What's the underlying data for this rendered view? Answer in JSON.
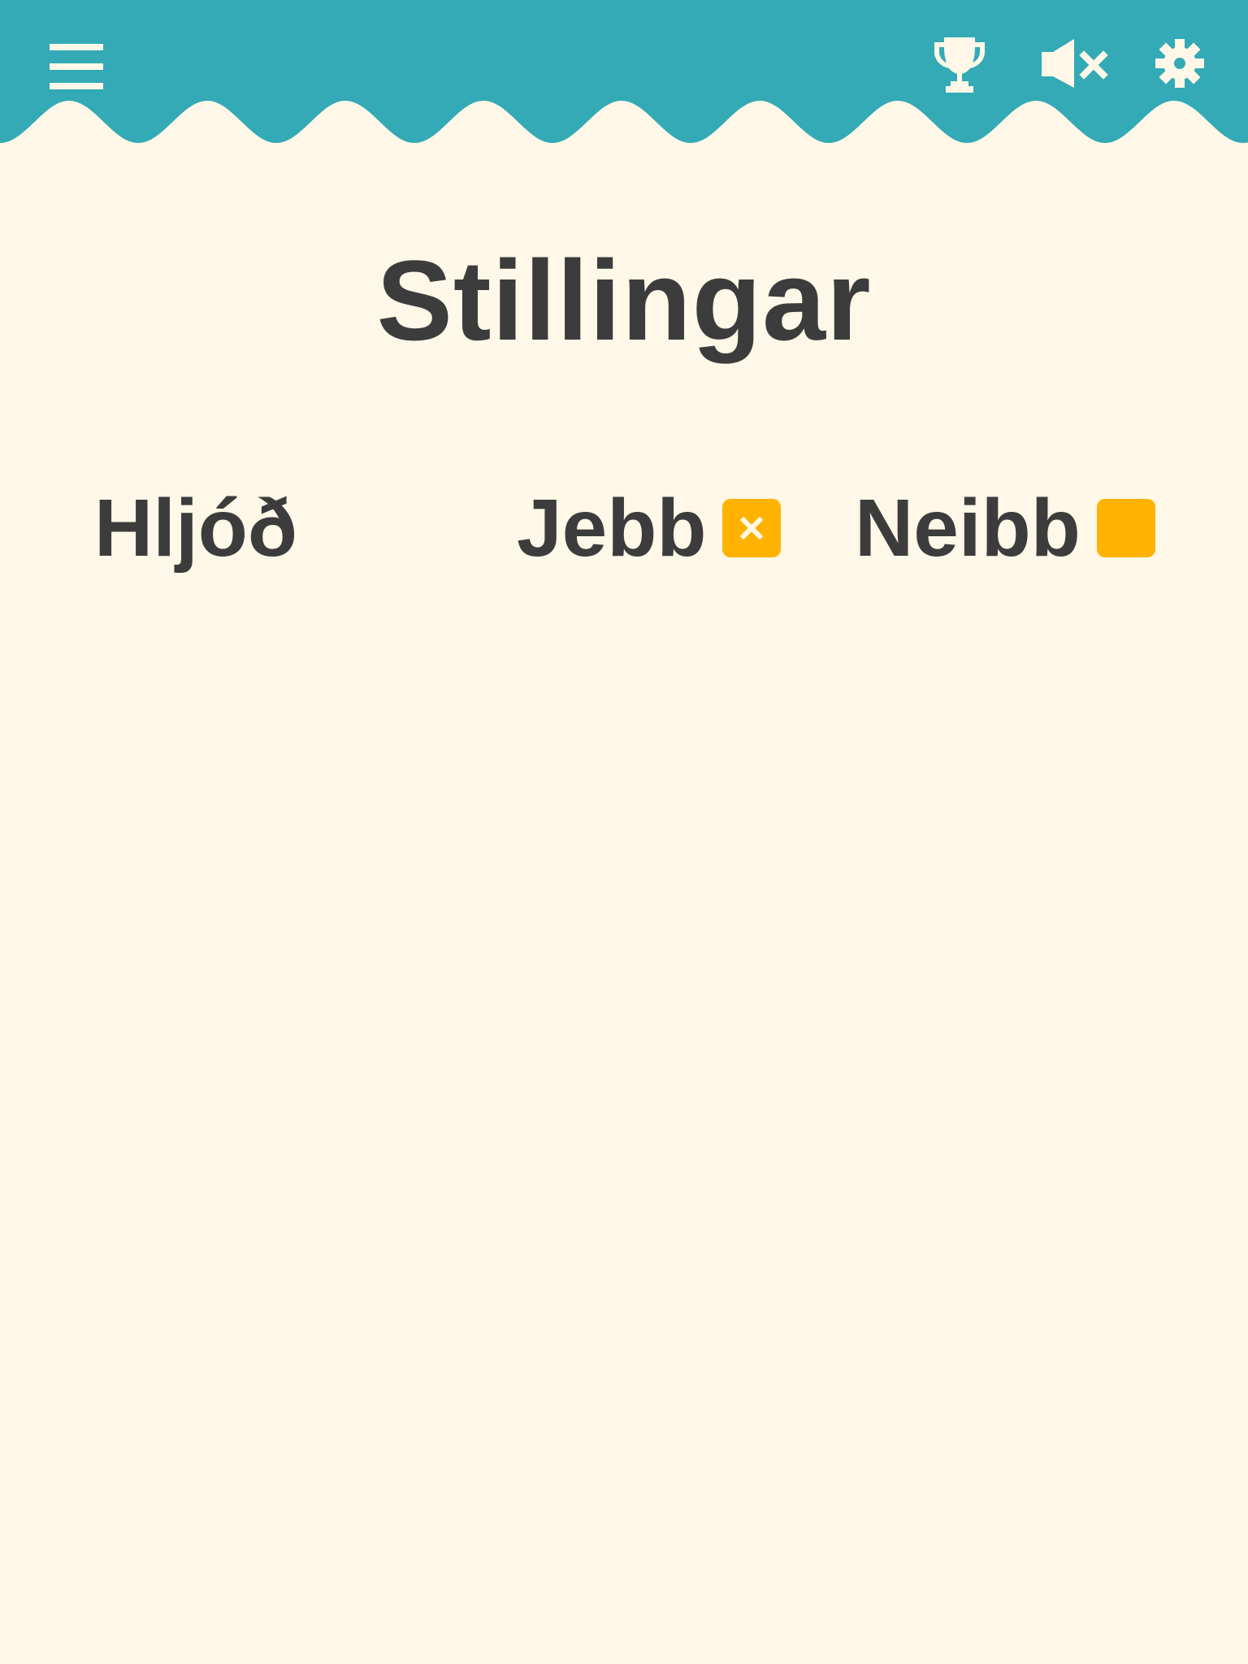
{
  "colors": {
    "header": "#33aab5",
    "background": "#fff8e8",
    "text": "#3c3c3c",
    "accent": "#ffb300",
    "icon": "#fff8e8"
  },
  "header": {
    "icons": [
      "hamburger-menu-icon",
      "trophy-icon",
      "sound-muted-icon",
      "gear-icon"
    ]
  },
  "page": {
    "title": "Stillingar"
  },
  "settings": {
    "sound": {
      "label": "Hljóð",
      "options": [
        {
          "label": "Jebb",
          "checked": true
        },
        {
          "label": "Neibb",
          "checked": false
        }
      ]
    }
  }
}
